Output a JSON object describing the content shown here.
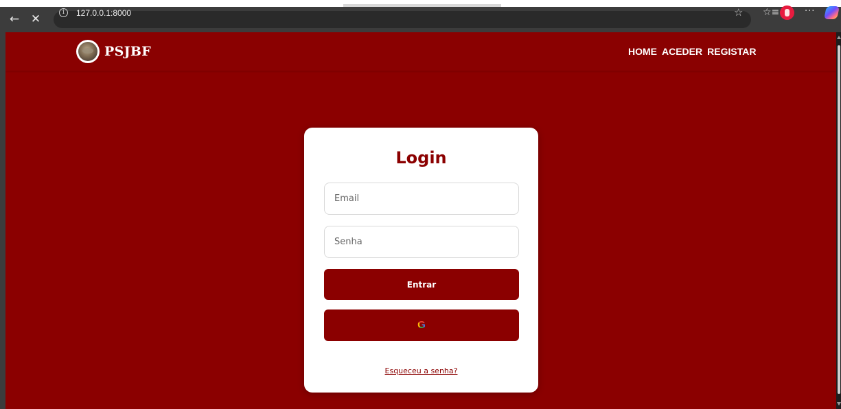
{
  "browser": {
    "url": "127.0.0.1:8000",
    "back_icon": "arrow-left-icon",
    "stop_icon": "close-icon",
    "toolbar_icons": [
      "info-icon",
      "star-icon",
      "favorites-icon",
      "profile-icon",
      "more-icon",
      "copilot-icon"
    ]
  },
  "site": {
    "brand": "PSJBF",
    "nav": [
      "HOME",
      "ACEDER",
      "REGISTAR"
    ]
  },
  "login": {
    "title": "Login",
    "email_placeholder": "Email",
    "password_placeholder": "Senha",
    "submit_label": "Entrar",
    "google_icon": "G",
    "forgot_link": "Esqueceu a senha?"
  },
  "colors": {
    "primary": "#8b0000",
    "card": "#ffffff",
    "browser_bar": "#3c3c3c"
  }
}
